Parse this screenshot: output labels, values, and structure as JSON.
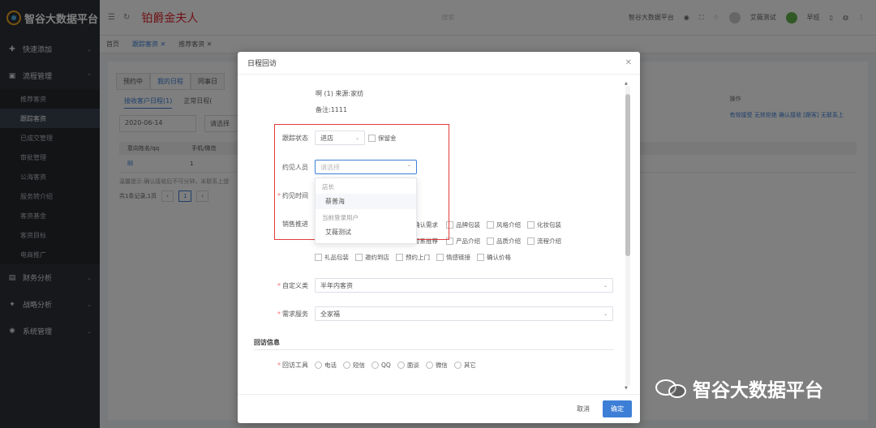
{
  "app": {
    "title": "智谷大数据平台"
  },
  "sidebar": {
    "groups": [
      {
        "label": "快速添加",
        "icon": "plus-circle-icon"
      },
      {
        "label": "流程管理",
        "icon": "folder-icon"
      }
    ],
    "items": [
      "推荐客资",
      "跟踪客资",
      "已成交管理",
      "审批管理",
      "公海客资",
      "服务转介绍",
      "客资基金",
      "客资目标",
      "电商推广"
    ],
    "bottom_groups": [
      {
        "label": "财务分析",
        "icon": "chart-icon"
      },
      {
        "label": "战略分析",
        "icon": "flag-icon"
      },
      {
        "label": "系统管理",
        "icon": "gear-icon"
      }
    ]
  },
  "topbar": {
    "page_title": "铂爵金夫人",
    "search": "搜索",
    "company": "智谷大数据平台",
    "user1": "艾薇测试",
    "user2": "早班"
  },
  "tabs": [
    "首页",
    "跟踪客资",
    "推荐客资"
  ],
  "main": {
    "tabs": [
      "预约中",
      "我的日程",
      "同事日"
    ],
    "subtabs": [
      "接收客户日程(1)",
      "正常日程("
    ],
    "date": "2020-06-14",
    "select_placeholder": "请选择",
    "headers": [
      "意向姓名/qq",
      "手机/微信"
    ],
    "row": {
      "name": "啊",
      "phone1": "1",
      "phone2": "1"
    },
    "note": "温馨提示:确认接收后不可分钟，未联系上提",
    "pager_text": "共1条记录,1页",
    "page": "1",
    "ops_header": "操作",
    "ops_links": "有效接受 无效拒绝 确认接收 [跟客] 无联系上"
  },
  "dialog": {
    "title": "日程回访",
    "source": "啊 (1) 来源:家纺",
    "remark": "备注:1111",
    "follow_status": {
      "label": "跟踪状态",
      "value": "进店",
      "deposit": "保留金"
    },
    "meet_person": {
      "label": "约见人员",
      "placeholder": "请选择"
    },
    "meet_time": {
      "label": "约见时间"
    },
    "sales": {
      "label": "销售推进",
      "row1": [
        "确认需求",
        "品牌包装",
        "风格介绍",
        "化妆包装"
      ],
      "row2": [
        "套系推荐",
        "产品介绍",
        "品质介绍",
        "流程介绍"
      ],
      "row3": [
        "礼品包装",
        "邀约到店",
        "预约上门",
        "情感链接",
        "确认价格"
      ]
    },
    "custom_type": {
      "label": "自定义类",
      "value": "半年内客资"
    },
    "service": {
      "label": "需求服务",
      "value": "全家福"
    },
    "section": "回访信息",
    "tools": {
      "label": "回访工具",
      "options": [
        "电话",
        "短信",
        "QQ",
        "面谈",
        "微信",
        "其它"
      ]
    },
    "dropdown": {
      "group1": "店长",
      "item1": "蔡普海",
      "group2": "当前登录用户",
      "item2": "艾薇测试"
    },
    "cancel": "取消",
    "ok": "确定"
  },
  "watermark": "智谷大数据平台",
  "colors": {
    "primary": "#3d7fd6",
    "highlight": "#e23b3b",
    "title_red": "#e0262e"
  }
}
